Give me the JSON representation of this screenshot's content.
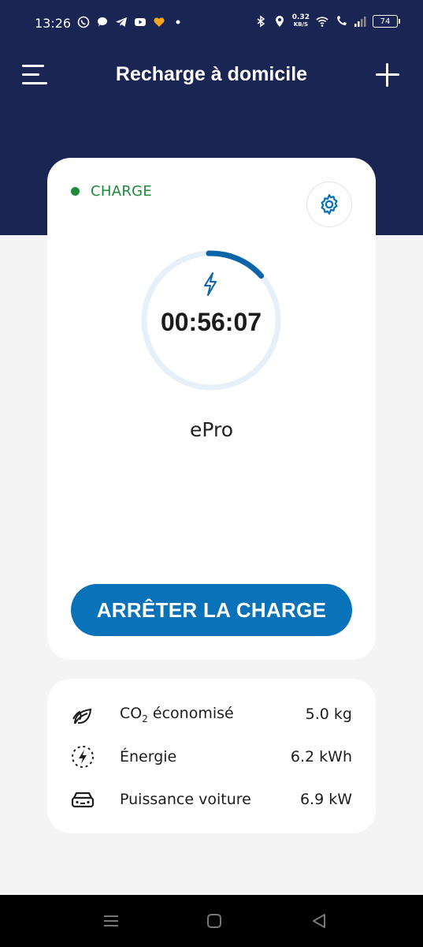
{
  "status_bar": {
    "time": "13:26",
    "net_speed_value": "0.32",
    "net_speed_unit": "KB/S",
    "battery": "74"
  },
  "header": {
    "title": "Recharge à domicile"
  },
  "session": {
    "status": "CHARGE",
    "status_color": "#1f8a3b",
    "timer": "00:56:07",
    "progress": 0.14,
    "charger_name": "ePro",
    "stop_label": "ARRÊTER LA CHARGE"
  },
  "stats": {
    "co2_label_prefix": "CO",
    "co2_label_sub": "2",
    "co2_label_suffix": " économisé",
    "co2_value": "5.0 kg",
    "energy_label": "Énergie",
    "energy_value": "6.2 kWh",
    "power_label": "Puissance voiture",
    "power_value": "6.9 kW"
  },
  "colors": {
    "header_bg": "#1a2554",
    "accent": "#0a72b8",
    "ring_track": "#e6f0f9"
  }
}
